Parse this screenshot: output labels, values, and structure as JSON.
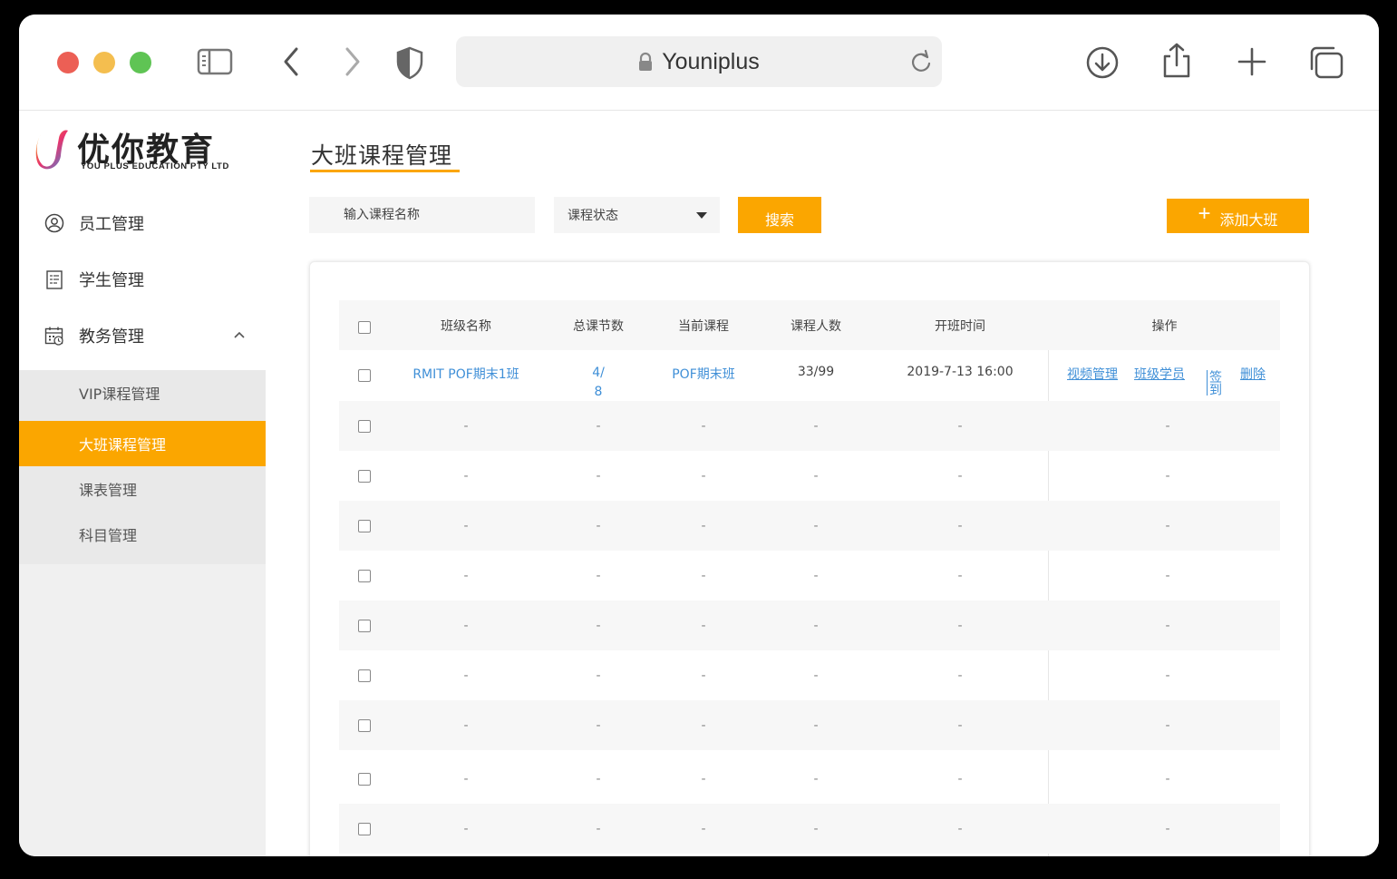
{
  "browser": {
    "url_text": "Youniplus"
  },
  "logo": {
    "title": "优你教育",
    "subtitle": "YOU PLUS EDUCATION PTY LTD"
  },
  "sidebar": {
    "items": [
      {
        "label": "员工管理",
        "icon": "user-circle-icon"
      },
      {
        "label": "学生管理",
        "icon": "document-list-icon"
      },
      {
        "label": "教务管理",
        "icon": "calendar-clock-icon"
      }
    ],
    "sub_items": [
      {
        "label": "VIP课程管理"
      },
      {
        "label": "大班课程管理"
      },
      {
        "label": "课表管理"
      },
      {
        "label": "科目管理"
      }
    ]
  },
  "page": {
    "title": "大班课程管理",
    "search_placeholder": "输入课程名称",
    "status_select_value": "课程状态",
    "search_button": "搜索",
    "add_button": "添加大班"
  },
  "table": {
    "headers": [
      "班级名称",
      "总课节数",
      "当前课程",
      "课程人数",
      "开班时间",
      "操作"
    ],
    "first_row": {
      "name": "RMIT POF期末1班",
      "lessons_line1": "4/",
      "lessons_line2": "8",
      "current": "POF期末班",
      "count": "33/99",
      "start": "2019-7-13 16:00",
      "actions": [
        "视频管理",
        "班级学员",
        "签到",
        "删除"
      ]
    },
    "empty_value": "-"
  },
  "colors": {
    "accent": "#fba600",
    "link": "#3f8fd7"
  }
}
